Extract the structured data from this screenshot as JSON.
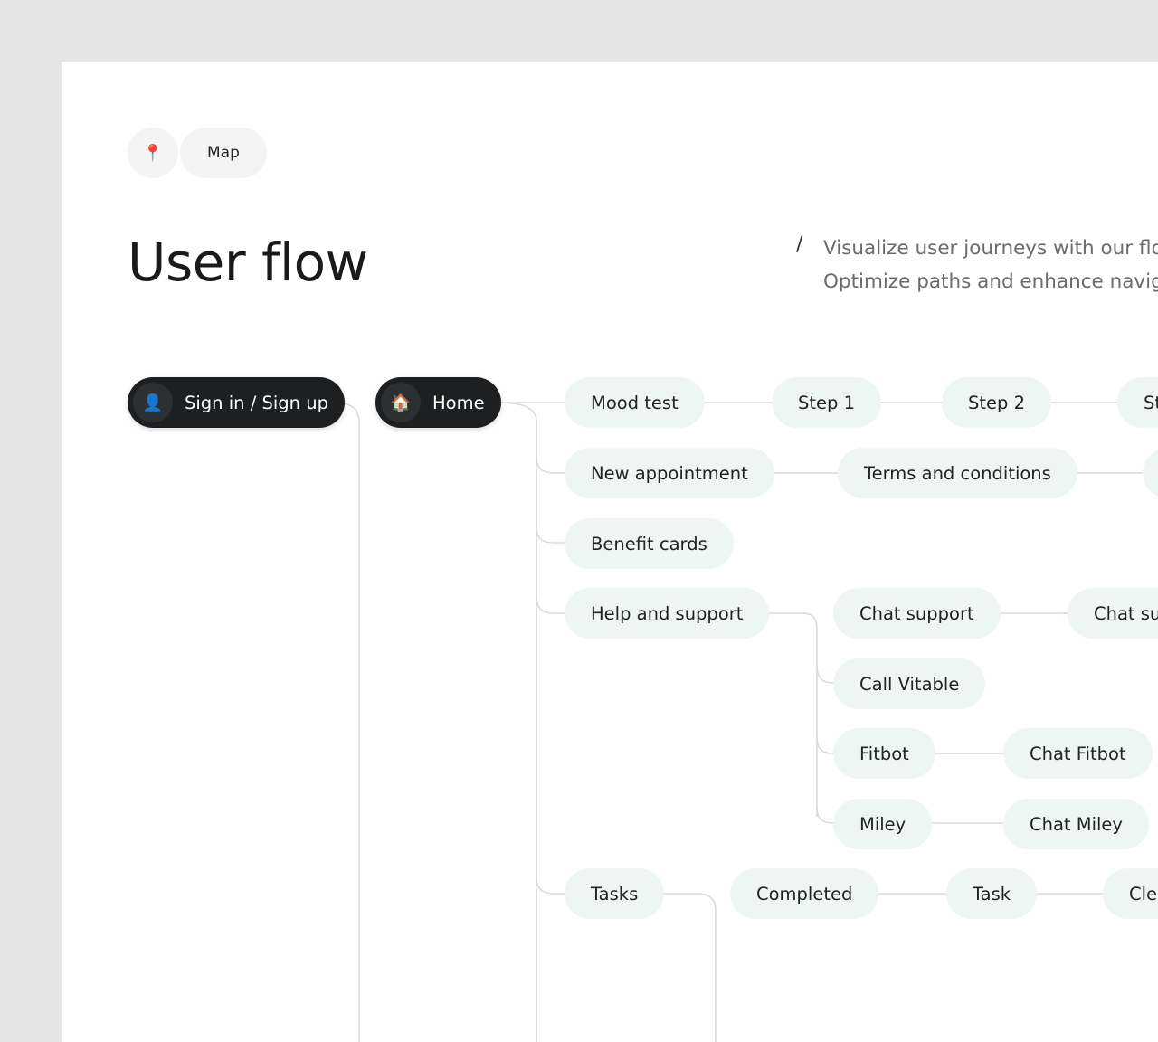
{
  "chip": {
    "icon": "pin-icon",
    "icon_glyph": "📍",
    "label": "Map"
  },
  "title": "User flow",
  "description": {
    "slash": "/",
    "line1": "Visualize user journeys with our flo",
    "line2": "Optimize paths and enhance navig"
  },
  "flow": {
    "sign_in": {
      "label": "Sign in / Sign up",
      "icon": "user-icon",
      "icon_glyph": "👤"
    },
    "home": {
      "label": "Home",
      "icon": "house-icon",
      "icon_glyph": "🏠"
    },
    "mood_test": "Mood test",
    "step1": "Step 1",
    "step2": "Step 2",
    "step3": "St",
    "new_appointment": "New appointment",
    "terms": "Terms and conditions",
    "benefit_cards": "Benefit cards",
    "help_support": "Help and support",
    "chat_support": "Chat support",
    "chat_support2": "Chat su",
    "call_vitable": "Call Vitable",
    "fitbot": "Fitbot",
    "chat_fitbot": "Chat Fitbot",
    "miley": "Miley",
    "chat_miley": "Chat Miley",
    "tasks": "Tasks",
    "completed": "Completed",
    "task": "Task",
    "clear": "Cle"
  },
  "colors": {
    "background": "#e5e5e5",
    "card": "#ffffff",
    "node": "#eef6f4",
    "dark_node": "#1d1f21",
    "line": "#d9d9d9"
  }
}
